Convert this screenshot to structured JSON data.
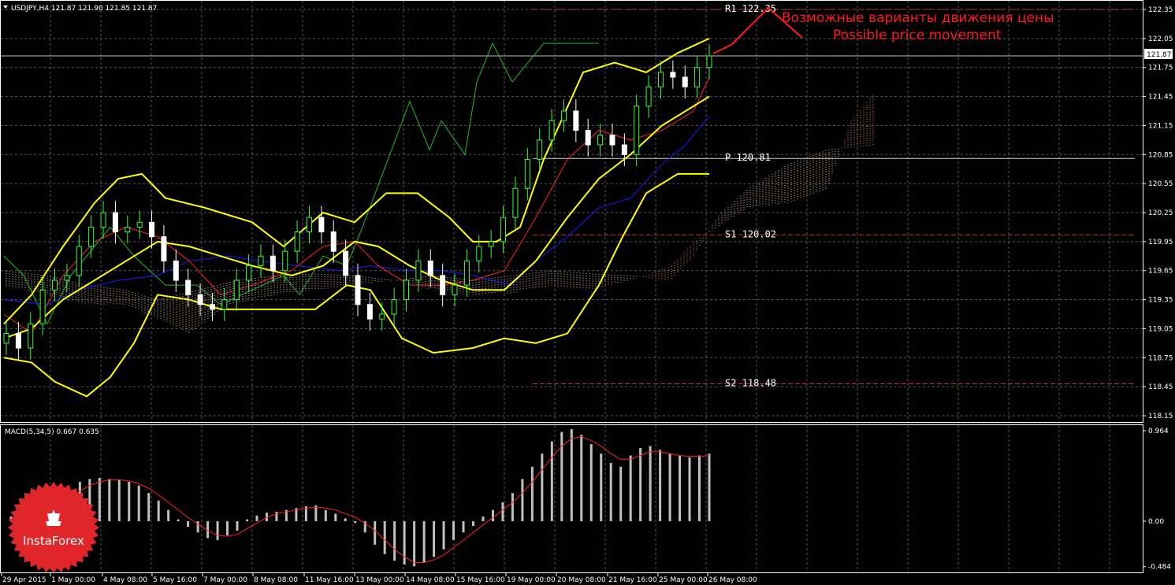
{
  "header": {
    "symbol_info": "USDJPY,H4  121.87 121.90 121.85 121.87",
    "menu_icon": "triangle-down-icon"
  },
  "macd_header": "MACD(5,34,5) 0.667 0.635",
  "annotation": {
    "line1": "Возможные варианты движения цены",
    "line2": "Possible price movement",
    "color": "#ff1a1a"
  },
  "levels": [
    {
      "name": "R1",
      "value": 122.35,
      "label": "R1  122.35",
      "color": "#cc3333"
    },
    {
      "name": "P",
      "value": 120.81,
      "label": "P  120.81",
      "color": "#d0d0d0"
    },
    {
      "name": "S1",
      "value": 120.02,
      "label": "S1  120.02",
      "color": "#cc3333"
    },
    {
      "name": "S2",
      "value": 118.48,
      "label": "S2  118.48",
      "color": "#cc3333"
    }
  ],
  "current_price": {
    "label": "121.87",
    "value": 121.87
  },
  "logo": {
    "text": "InstaForex",
    "color": "#e0262b"
  },
  "colors": {
    "bull": "#33ff33",
    "bear": "#ffffff",
    "bands": "#ffff00",
    "tenkan": "#ff2222",
    "kijun": "#1a1aff",
    "chikou": "#22bb22",
    "macd_hist": "#c0c0c0",
    "macd_signal": "#ff2222",
    "grid": "#5a5a5a"
  },
  "chart_data": [
    {
      "type": "line",
      "title": "USDJPY,H4",
      "y_ticks": [
        "122.35",
        "122.05",
        "121.75",
        "121.45",
        "121.15",
        "120.85",
        "120.55",
        "120.25",
        "119.95",
        "119.65",
        "119.35",
        "119.05",
        "118.75",
        "118.45",
        "118.15"
      ],
      "ylim": [
        118.05,
        122.4
      ],
      "x_ticks": [
        "29 Apr 2015",
        "1 May 00:00",
        "4 May 08:00",
        "5 May 16:00",
        "7 May 00:00",
        "8 May 08:00",
        "11 May 16:00",
        "13 May 00:00",
        "14 May 08:00",
        "15 May 16:00",
        "19 May 00:00",
        "20 May 08:00",
        "21 May 16:00",
        "25 May 00:00",
        "26 May 08:00"
      ],
      "series": [
        {
          "name": "Close",
          "values": [
            119.0,
            118.85,
            119.1,
            119.45,
            119.55,
            119.6,
            119.9,
            120.1,
            120.25,
            120.05,
            120.1,
            120.15,
            120.0,
            119.75,
            119.55,
            119.4,
            119.3,
            119.25,
            119.35,
            119.55,
            119.7,
            119.8,
            119.65,
            119.85,
            120.05,
            120.2,
            120.05,
            119.85,
            119.6,
            119.3,
            119.15,
            119.2,
            119.35,
            119.55,
            119.75,
            119.6,
            119.4,
            119.5,
            119.75,
            119.9,
            119.95,
            120.2,
            120.5,
            120.8,
            121.0,
            121.2,
            121.3,
            121.1,
            120.95,
            121.05,
            120.95,
            120.85,
            121.35,
            121.55,
            121.7,
            121.65,
            121.55,
            121.75,
            121.87
          ]
        }
      ]
    },
    {
      "type": "bar",
      "title": "MACD(5,34,5)",
      "ylim": [
        -0.484,
        0.964
      ],
      "y_ticks": [
        "0.964",
        "0.00",
        "-0.484"
      ],
      "series": [
        {
          "name": "MACD",
          "values": [
            0.05,
            0.02,
            0.05,
            0.08,
            0.15,
            0.25,
            0.33,
            0.42,
            0.45,
            0.46,
            0.45,
            0.44,
            0.42,
            0.38,
            0.3,
            0.22,
            0.12,
            0.02,
            -0.06,
            -0.12,
            -0.18,
            -0.2,
            -0.15,
            -0.1,
            0.02,
            0.06,
            0.09,
            0.1,
            0.12,
            0.14,
            0.16,
            0.17,
            0.12,
            0.08,
            0.03,
            -0.02,
            -0.12,
            -0.25,
            -0.35,
            -0.42,
            -0.46,
            -0.48,
            -0.44,
            -0.38,
            -0.3,
            -0.2,
            -0.12,
            -0.05,
            0.05,
            0.12,
            0.2,
            0.3,
            0.45,
            0.58,
            0.72,
            0.85,
            0.95,
            0.98,
            0.92,
            0.82,
            0.72,
            0.62,
            0.58,
            0.7,
            0.78,
            0.8,
            0.76,
            0.72,
            0.7,
            0.68,
            0.7,
            0.72
          ]
        },
        {
          "name": "Signal",
          "values": [
            0.02,
            0.03,
            0.04,
            0.06,
            0.1,
            0.16,
            0.24,
            0.32,
            0.38,
            0.42,
            0.44,
            0.44,
            0.43,
            0.4,
            0.35,
            0.28,
            0.2,
            0.12,
            0.04,
            -0.03,
            -0.1,
            -0.15,
            -0.16,
            -0.14,
            -0.08,
            -0.02,
            0.04,
            0.08,
            0.1,
            0.12,
            0.14,
            0.15,
            0.14,
            0.12,
            0.08,
            0.04,
            -0.02,
            -0.1,
            -0.2,
            -0.3,
            -0.38,
            -0.44,
            -0.44,
            -0.41,
            -0.36,
            -0.28,
            -0.2,
            -0.12,
            -0.04,
            0.04,
            0.12,
            0.2,
            0.3,
            0.42,
            0.55,
            0.68,
            0.8,
            0.88,
            0.9,
            0.86,
            0.8,
            0.72,
            0.66,
            0.66,
            0.7,
            0.74,
            0.74,
            0.72,
            0.7,
            0.69,
            0.69,
            0.7
          ]
        }
      ]
    }
  ]
}
